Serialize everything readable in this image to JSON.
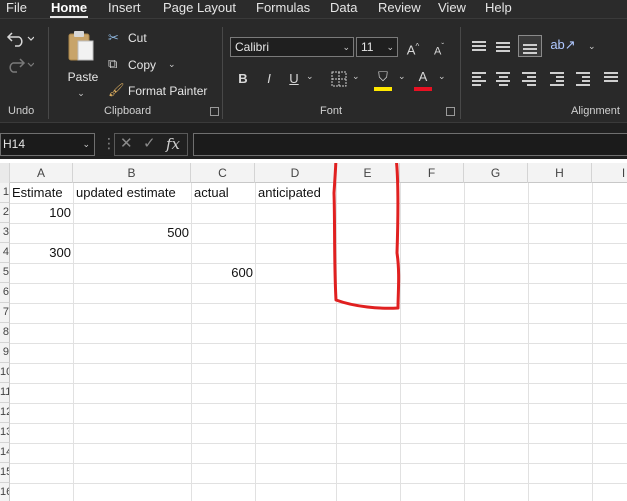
{
  "menu": {
    "tabs": [
      "File",
      "Home",
      "Insert",
      "Page Layout",
      "Formulas",
      "Data",
      "Review",
      "View",
      "Help"
    ],
    "active": "Home"
  },
  "ribbon": {
    "undo_group": "Undo",
    "clipboard_group": "Clipboard",
    "font_group": "Font",
    "alignment_group": "Alignment",
    "paste": "Paste",
    "cut": "Cut",
    "copy": "Copy",
    "format_painter": "Format Painter",
    "font_name": "Calibri",
    "font_size": "11",
    "bold": "B",
    "italic": "I",
    "underline": "U",
    "font_color_swatch": "#e81123",
    "fill_color_swatch": "#ffe800",
    "grow_font": "A",
    "shrink_font": "A",
    "font_color_letter": "A"
  },
  "formula_bar": {
    "name_box": "H14",
    "fx": "fx",
    "value": ""
  },
  "sheet": {
    "columns": [
      "A",
      "B",
      "C",
      "D",
      "E",
      "F",
      "G",
      "H",
      "I"
    ],
    "rows": [
      "1",
      "2",
      "3",
      "4",
      "5",
      "6",
      "7",
      "8",
      "9",
      "10",
      "11",
      "12",
      "13",
      "14",
      "15",
      "16"
    ],
    "cells": {
      "A1": "Estimate",
      "B1": "updated estimate",
      "C1": "actual",
      "D1": "anticipated",
      "A2": "100",
      "B3": "500",
      "A4": "300",
      "C5": "600"
    },
    "highlight_color": "#e02020"
  }
}
